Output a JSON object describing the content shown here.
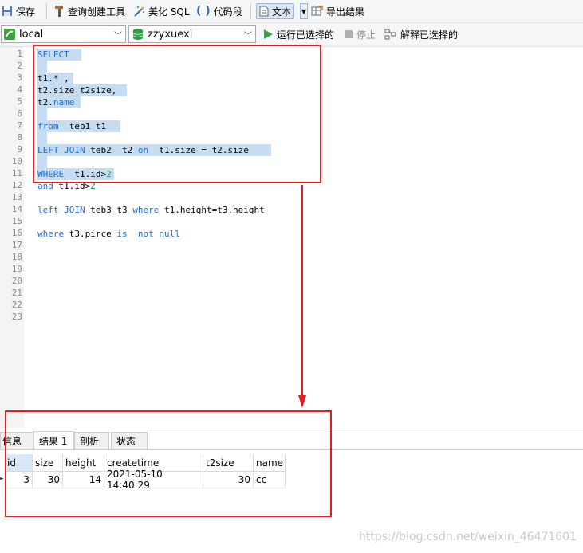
{
  "toolbar": {
    "save": "保存",
    "query_builder": "查询创建工具",
    "beautify": "美化 SQL",
    "snippet": "代码段",
    "text": "文本",
    "export": "导出结果"
  },
  "toolbar2": {
    "connection": "local",
    "database": "zzyxuexi",
    "run_selected": "运行已选择的",
    "stop": "停止",
    "explain_selected": "解释已选择的"
  },
  "editor": {
    "line_numbers": [
      "1",
      "2",
      "3",
      "4",
      "5",
      "6",
      "7",
      "8",
      "9",
      "10",
      "11",
      "12",
      "13",
      "14",
      "15",
      "16",
      "17",
      "18",
      "19",
      "20",
      "21",
      "22",
      "23"
    ],
    "l1": "SELECT",
    "l3": "t1.* ,",
    "l4": "t2.size t2size,",
    "l5a": "t2.",
    "l5b": "name",
    "l7a": "from",
    "l7b": "  teb1 t1",
    "l9a": "LEFT JOIN",
    "l9b": " teb2  t2 ",
    "l9c": "on",
    "l9d": "  t1.size = t2.size",
    "l11a": "WHERE",
    "l11b": "  t1.id>",
    "l11c": "2",
    "l12a": "and",
    "l12b": " t1.id>",
    "l12c": "2",
    "l14a": "left JOIN",
    "l14b": " teb3 t3 ",
    "l14c": "where",
    "l14d": " t1.height=t3.height",
    "l16a": "where",
    "l16b": " t3.pirce ",
    "l16c": "is",
    "l16d": "  ",
    "l16e": "not null"
  },
  "results": {
    "tabs": [
      "信息",
      "结果 1",
      "剖析",
      "状态"
    ],
    "columns": [
      "id",
      "size",
      "height",
      "createtime",
      "t2size",
      "name"
    ],
    "row": [
      "3",
      "30",
      "14",
      "2021-05-10 14:40:29",
      "30",
      "cc"
    ]
  },
  "watermark": "https://blog.csdn.net/weixin_46471601",
  "colors": {
    "annotation_red": "#e02020",
    "keyword_blue": "#1e6fd9",
    "selection": "#c6dcf2"
  }
}
